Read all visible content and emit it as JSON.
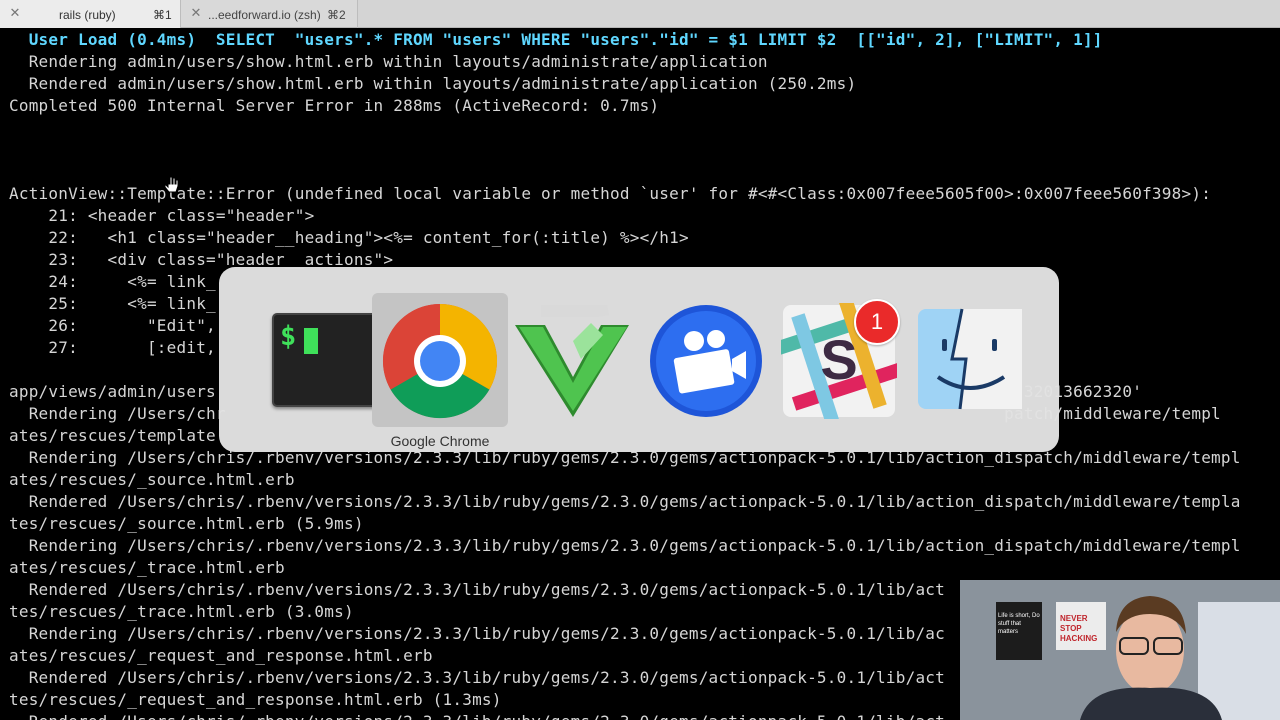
{
  "tabs": [
    {
      "title": "rails (ruby)",
      "shortcut": "⌘1",
      "active": true
    },
    {
      "title": "...eedforward.io (zsh)",
      "shortcut": "⌘2",
      "active": false
    }
  ],
  "terminal": {
    "lines": [
      "  User Load (0.4ms)  SELECT  \"users\".* FROM \"users\" WHERE \"users\".\"id\" = $1 LIMIT $2  [[\"id\", 2], [\"LIMIT\", 1]]",
      "  Rendering admin/users/show.html.erb within layouts/administrate/application",
      "  Rendered admin/users/show.html.erb within layouts/administrate/application (250.2ms)",
      "Completed 500 Internal Server Error in 288ms (ActiveRecord: 0.7ms)",
      "",
      "",
      "ActionView::Template::Error (undefined local variable or method `user' for #<#<Class:0x007feee5605f00>:0x007feee560f398>):",
      "    21: <header class=\"header\">",
      "    22:   <h1 class=\"header__heading\"><%= content_for(:title) %></h1>",
      "    23:   <div class=\"header__actions\">",
      "    24:     <%= link_",
      "    25:     <%= link_",
      "    26:       \"Edit\",",
      "    27:       [:edit,",
      "",
      "app/views/admin/users                                                                                  32013662320'",
      "  Rendering /Users/chr                                                                               patch/middleware/templ",
      "ates/rescues/template",
      "  Rendering /Users/chris/.rbenv/versions/2.3.3/lib/ruby/gems/2.3.0/gems/actionpack-5.0.1/lib/action_dispatch/middleware/templ",
      "ates/rescues/_source.html.erb",
      "  Rendered /Users/chris/.rbenv/versions/2.3.3/lib/ruby/gems/2.3.0/gems/actionpack-5.0.1/lib/action_dispatch/middleware/templa",
      "tes/rescues/_source.html.erb (5.9ms)",
      "  Rendering /Users/chris/.rbenv/versions/2.3.3/lib/ruby/gems/2.3.0/gems/actionpack-5.0.1/lib/action_dispatch/middleware/templ",
      "ates/rescues/_trace.html.erb",
      "  Rendered /Users/chris/.rbenv/versions/2.3.3/lib/ruby/gems/2.3.0/gems/actionpack-5.0.1/lib/act",
      "tes/rescues/_trace.html.erb (3.0ms)",
      "  Rendering /Users/chris/.rbenv/versions/2.3.3/lib/ruby/gems/2.3.0/gems/actionpack-5.0.1/lib/ac",
      "ates/rescues/_request_and_response.html.erb",
      "  Rendered /Users/chris/.rbenv/versions/2.3.3/lib/ruby/gems/2.3.0/gems/actionpack-5.0.1/lib/act",
      "tes/rescues/_request_and_response.html.erb (1.3ms)",
      "  Rendered /Users/chris/.rbenv/versions/2.3.3/lib/ruby/gems/2.3.0/gems/actionpack-5.0.1/lib/act"
    ]
  },
  "app_switcher": {
    "selected_label": "Google Chrome",
    "apps": [
      {
        "name": "terminal-icon",
        "prompt": "$"
      },
      {
        "name": "chrome-icon"
      },
      {
        "name": "vim-icon"
      },
      {
        "name": "screenflow-icon"
      },
      {
        "name": "slack-icon",
        "badge": "1"
      },
      {
        "name": "finder-icon"
      }
    ]
  },
  "webcam": {
    "poster_left": "Life is short, Do stuff that matters",
    "poster_right": "NEVER STOP HACKING"
  },
  "colors": {
    "terminal_bg": "#000000",
    "terminal_fg": "#d6d6d6",
    "sql_highlight": "#5fd7ff",
    "badge_red": "#ea2a2a"
  }
}
